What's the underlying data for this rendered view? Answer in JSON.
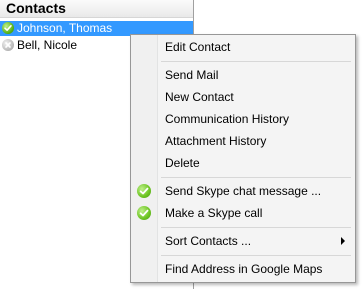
{
  "contacts_panel": {
    "title": "Contacts",
    "items": [
      {
        "name": "Johnson, Thomas",
        "status": "online",
        "selected": true
      },
      {
        "name": "Bell, Nicole",
        "status": "offline",
        "selected": false
      }
    ]
  },
  "context_menu": {
    "edit_contact": "Edit Contact",
    "send_mail": "Send Mail",
    "new_contact": "New Contact",
    "communication_history": "Communication History",
    "attachment_history": "Attachment History",
    "delete": "Delete",
    "send_skype_chat": "Send Skype chat message ...",
    "make_skype_call": "Make a Skype call",
    "sort_contacts": "Sort Contacts ...",
    "find_address": "Find Address in Google Maps"
  },
  "colors": {
    "selection": "#3399ff",
    "menu_background": "#f4f4f4",
    "status_online": "#54b012",
    "status_offline": "#b5b5b5"
  }
}
